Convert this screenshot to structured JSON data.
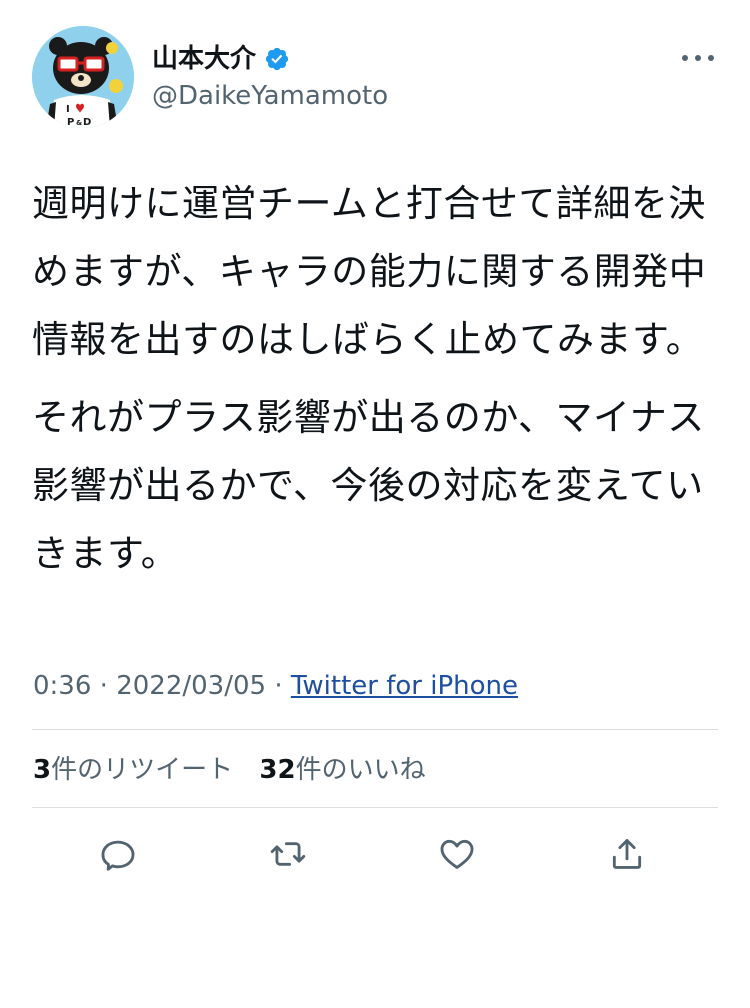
{
  "user": {
    "display_name": "山本大介",
    "handle": "@DaikeYamamoto",
    "avatar_text": "I ♥ P&D"
  },
  "tweet": {
    "paragraphs": [
      "週明けに運営チームと打合せて詳細を決めますが、キャラの能力に関する開発中情報を出すのはしばらく止めてみます。",
      "それがプラス影響が出るのか、マイナス影響が出るかで、今後の対応を変えていきます。"
    ],
    "time": "0:36",
    "date": "2022/03/05",
    "separator": "·",
    "source": "Twitter for iPhone"
  },
  "stats": {
    "retweets_count": "3",
    "retweets_label": "件のリツイート",
    "likes_count": "32",
    "likes_label": "件のいいね"
  },
  "colors": {
    "text": "#0f1419",
    "muted": "#536471",
    "link": "#1d4fa0",
    "verified": "#1d9bf0",
    "divider": "#dcdfe2"
  },
  "icons": {
    "reply": "reply-icon",
    "retweet": "retweet-icon",
    "like": "heart-icon",
    "share": "share-icon",
    "more": "more-icon",
    "verified": "verified-badge-icon"
  }
}
